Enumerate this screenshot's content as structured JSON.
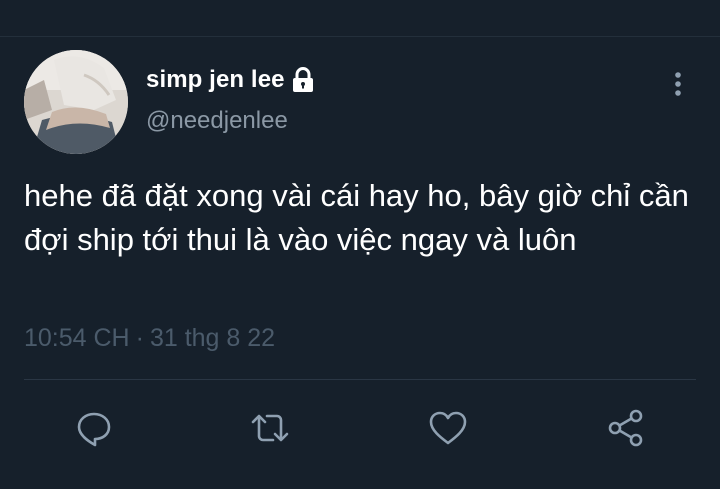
{
  "tweet": {
    "display_name": "simp jen lee",
    "handle": "@needjenlee",
    "text": "hehe đã đặt xong vài cái hay ho, bây giờ chỉ cần đợi ship tới thui là vào việc ngay và luôn",
    "time": "10:54 CH",
    "separator": "·",
    "date": "31 thg 8 22"
  },
  "icons": {
    "lock": "lock-icon",
    "more": "more-vertical-icon",
    "reply": "reply-icon",
    "retweet": "retweet-icon",
    "like": "like-icon",
    "share": "share-icon"
  },
  "colors": {
    "background": "#16202b",
    "text_primary": "#ffffff",
    "text_secondary": "#8b98a5",
    "text_meta": "#4b5b6b",
    "icon": "#8fa0b1"
  }
}
